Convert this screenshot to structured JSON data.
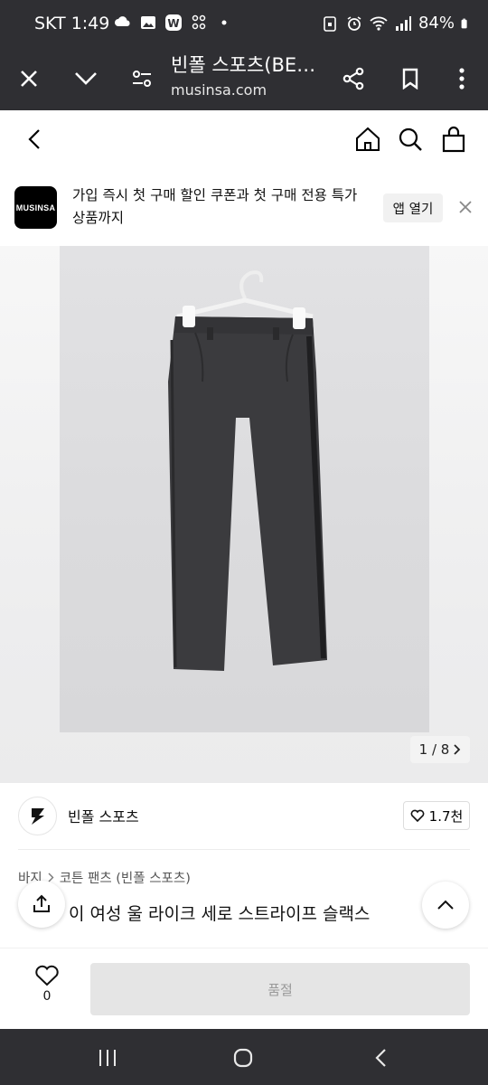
{
  "status_bar": {
    "carrier_time": "SKT 1:49",
    "battery": "84%"
  },
  "browser": {
    "title": "빈폴 스포츠(BE…",
    "url": "musinsa.com"
  },
  "banner": {
    "logo_text": "MUSINSA",
    "message": "가입 즉시 첫 구매 할인 쿠폰과 첫 구매 전용 특가 상품까지",
    "open_app": "앱 열기"
  },
  "gallery": {
    "counter": "1 / 8"
  },
  "brand": {
    "name": "빈폴 스포츠",
    "likes": "1.7천"
  },
  "breadcrumb": {
    "category": "바지",
    "subcategory": "코튼 팬츠 (빈폴 스포츠)"
  },
  "product": {
    "title": "이 여성 울 라이크 세로 스트라이프 슬랙스"
  },
  "bottom": {
    "wish_count": "0",
    "soldout_label": "품절"
  }
}
